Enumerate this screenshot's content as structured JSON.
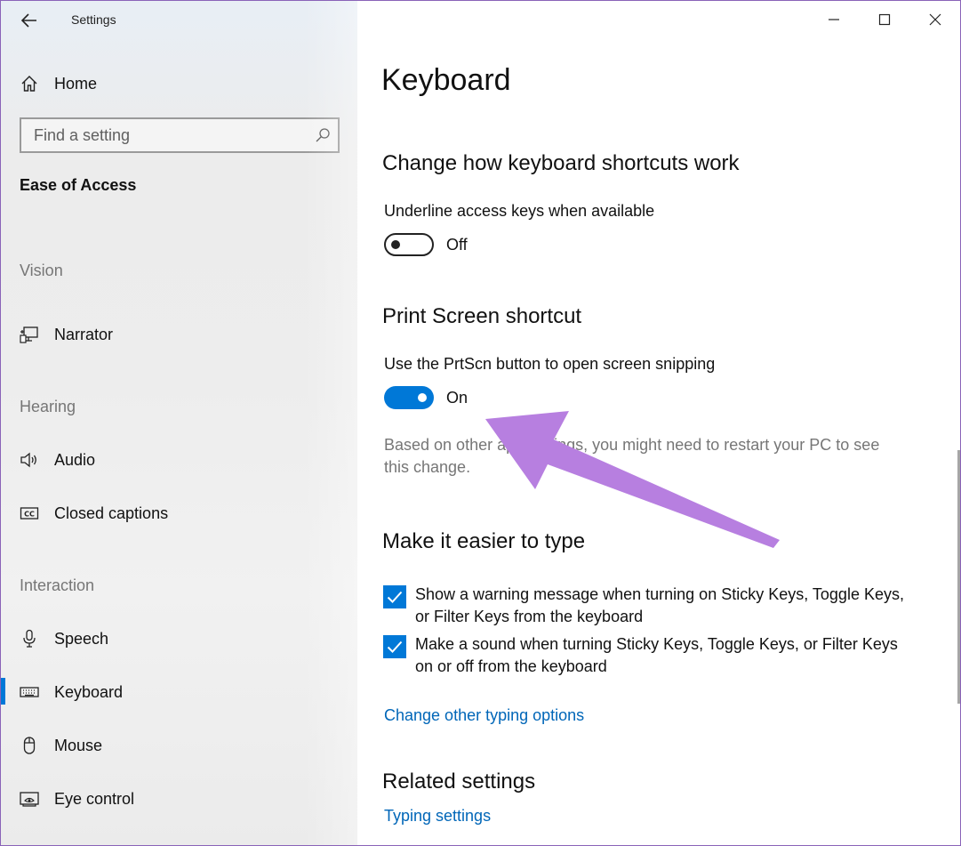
{
  "window": {
    "title": "Settings",
    "controls": {
      "minimize": "minimize-icon",
      "maximize": "maximize-icon",
      "close": "close-icon"
    }
  },
  "sidebar": {
    "home_label": "Home",
    "search": {
      "placeholder": "Find a setting"
    },
    "section_title": "Ease of Access",
    "groups": [
      {
        "header": "Vision",
        "items": [
          {
            "label": "Narrator",
            "icon": "narrator-icon"
          }
        ]
      },
      {
        "header": "Hearing",
        "items": [
          {
            "label": "Audio",
            "icon": "speaker-icon"
          },
          {
            "label": "Closed captions",
            "icon": "captions-icon"
          }
        ]
      },
      {
        "header": "Interaction",
        "items": [
          {
            "label": "Speech",
            "icon": "microphone-icon"
          },
          {
            "label": "Keyboard",
            "icon": "keyboard-icon",
            "active": true
          },
          {
            "label": "Mouse",
            "icon": "mouse-icon"
          },
          {
            "label": "Eye control",
            "icon": "eye-control-icon"
          }
        ]
      }
    ]
  },
  "content": {
    "page_title": "Keyboard",
    "shortcuts": {
      "heading": "Change how keyboard shortcuts work",
      "underline_label": "Underline access keys when available",
      "underline_state": "Off"
    },
    "print_screen": {
      "heading": "Print Screen shortcut",
      "prtscn_label": "Use the PrtScn button to open screen snipping",
      "prtscn_state": "On",
      "note": "Based on other app settings, you might need to restart your PC to see this change."
    },
    "easier_type": {
      "heading": "Make it easier to type",
      "options": [
        {
          "label": "Show a warning message when turning on Sticky Keys, Toggle Keys, or Filter Keys from the keyboard",
          "checked": true
        },
        {
          "label": "Make a sound when turning Sticky Keys, Toggle Keys, or Filter Keys on or off from the keyboard",
          "checked": true
        }
      ],
      "link": "Change other typing options"
    },
    "related": {
      "heading": "Related settings",
      "link": "Typing settings"
    }
  },
  "colors": {
    "accent": "#0078d7",
    "link": "#0066b8",
    "annotation_arrow": "#b77fe0"
  }
}
